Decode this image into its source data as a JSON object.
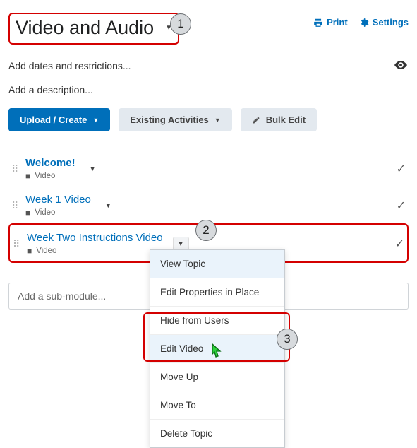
{
  "header": {
    "module_title": "Video and Audio",
    "print": "Print",
    "settings": "Settings"
  },
  "meta": {
    "dates": "Add dates and restrictions...",
    "description": "Add a description..."
  },
  "actions": {
    "upload_create": "Upload / Create",
    "existing_activities": "Existing Activities",
    "bulk_edit": "Bulk Edit"
  },
  "items": [
    {
      "title": "Welcome!",
      "type": "Video"
    },
    {
      "title": "Week 1 Video",
      "type": "Video"
    },
    {
      "title": "Week Two Instructions Video",
      "type": "Video"
    }
  ],
  "add_sub_placeholder": "Add a sub-module...",
  "menu": {
    "view_topic": "View Topic",
    "edit_properties": "Edit Properties in Place",
    "hide": "Hide from Users",
    "edit_video": "Edit Video",
    "move_up": "Move Up",
    "move_to": "Move To",
    "delete": "Delete Topic"
  },
  "callouts": {
    "one": "1",
    "two": "2",
    "three": "3"
  }
}
